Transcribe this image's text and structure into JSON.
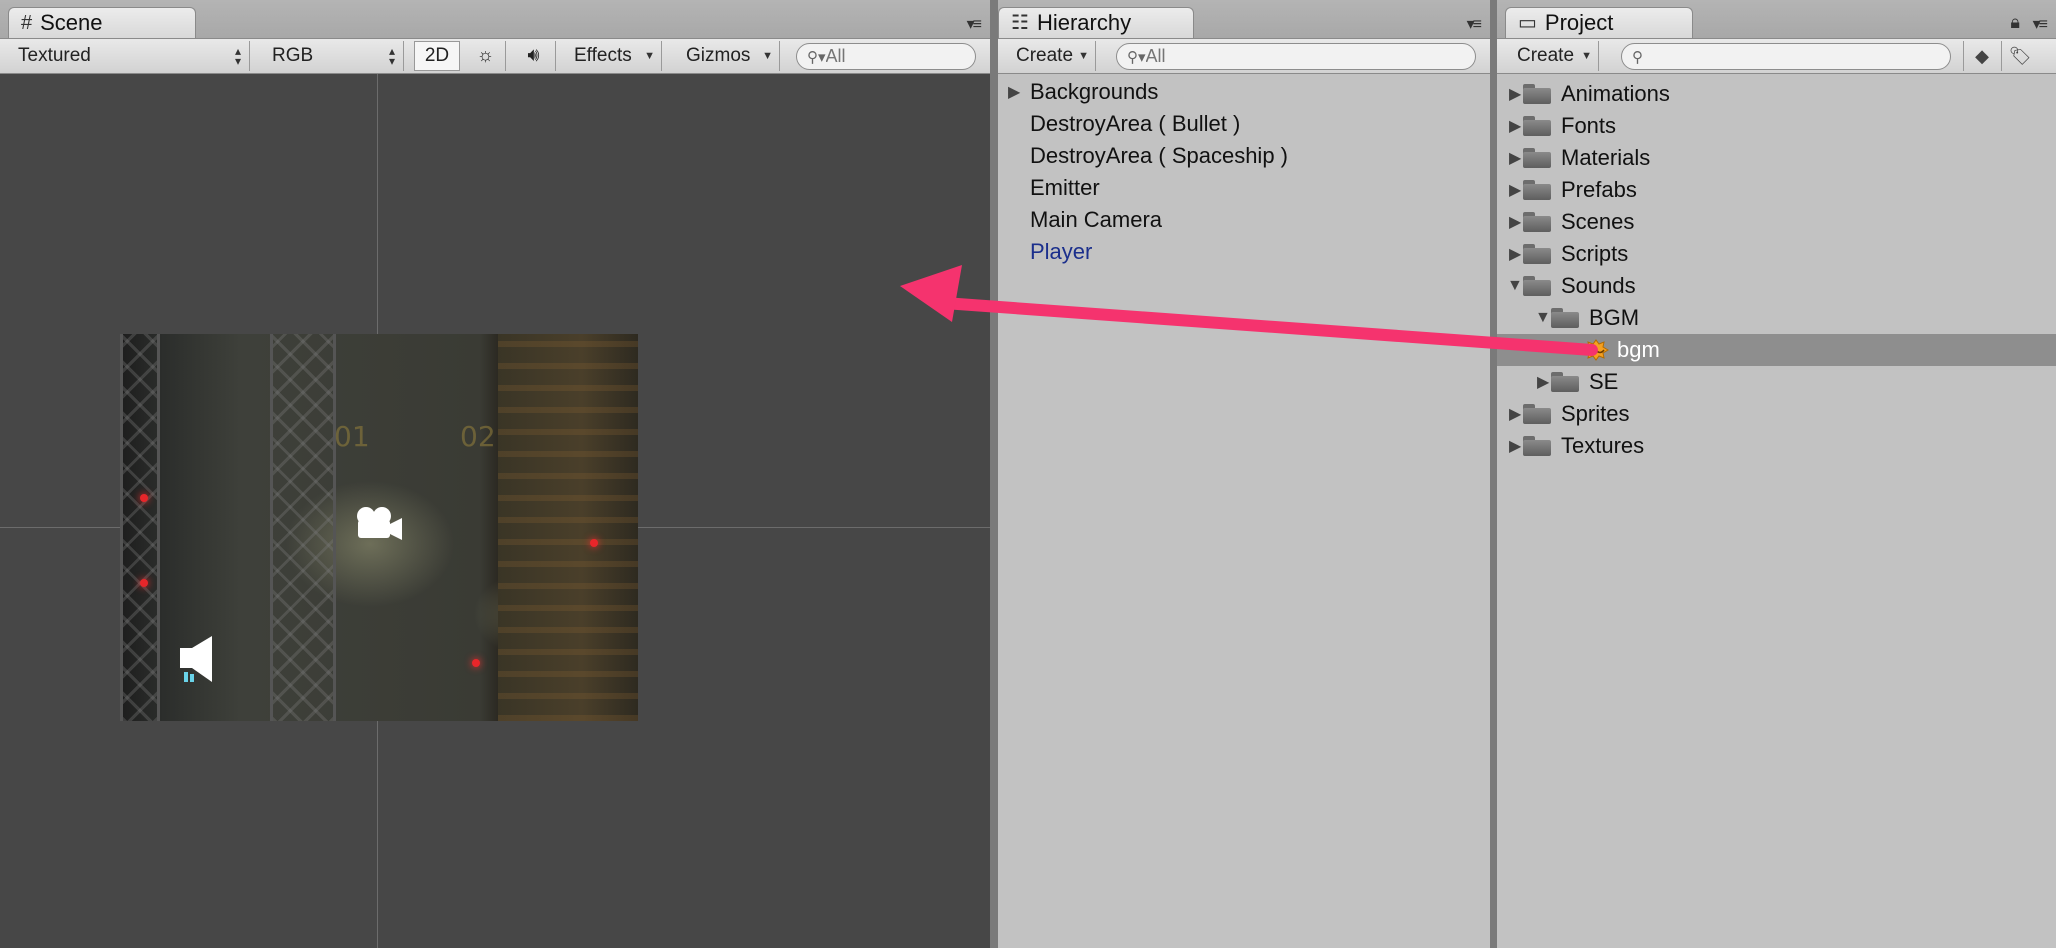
{
  "scene": {
    "tab": "Scene",
    "tab_icon": "grid-icon",
    "render_mode": "Textured",
    "color_mode": "RGB",
    "toggle_2d": "2D",
    "effects_label": "Effects",
    "gizmos_label": "Gizmos",
    "search_placeholder": "All",
    "bg_labels": [
      "01",
      "02"
    ]
  },
  "hierarchy": {
    "tab": "Hierarchy",
    "tab_icon": "list-icon",
    "create_label": "Create",
    "search_placeholder": "All",
    "items": [
      {
        "label": "Backgrounds",
        "expandable": true
      },
      {
        "label": "DestroyArea ( Bullet )",
        "expandable": false
      },
      {
        "label": "DestroyArea ( Spaceship )",
        "expandable": false
      },
      {
        "label": "Emitter",
        "expandable": false
      },
      {
        "label": "Main Camera",
        "expandable": false
      },
      {
        "label": "Player",
        "expandable": false,
        "highlight_color": "#1b2f8c"
      }
    ]
  },
  "project": {
    "tab": "Project",
    "tab_icon": "folder-icon",
    "create_label": "Create",
    "search_placeholder": "",
    "items": [
      {
        "label": "Animations",
        "type": "folder",
        "expanded": false
      },
      {
        "label": "Fonts",
        "type": "folder",
        "expanded": false
      },
      {
        "label": "Materials",
        "type": "folder",
        "expanded": false
      },
      {
        "label": "Prefabs",
        "type": "folder",
        "expanded": false
      },
      {
        "label": "Scenes",
        "type": "folder",
        "expanded": false
      },
      {
        "label": "Scripts",
        "type": "folder",
        "expanded": false
      },
      {
        "label": "Sounds",
        "type": "folder",
        "expanded": true
      },
      {
        "label": "BGM",
        "type": "folder",
        "expanded": true
      },
      {
        "label": "bgm",
        "type": "audio",
        "selected": true
      },
      {
        "label": "SE",
        "type": "folder",
        "expanded": false
      },
      {
        "label": "Sprites",
        "type": "folder",
        "expanded": false
      },
      {
        "label": "Textures",
        "type": "folder",
        "expanded": false
      }
    ]
  },
  "colors": {
    "drag_arrow": "#f5336e",
    "selection": "#8e8e8e",
    "scene_bg": "#474747"
  }
}
